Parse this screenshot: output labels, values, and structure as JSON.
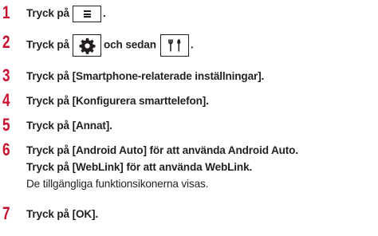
{
  "steps": [
    {
      "num": "1",
      "pre": "Tryck på",
      "icon": "menu-icon",
      "post": "."
    },
    {
      "num": "2",
      "pre": "Tryck på",
      "icon": "settings-gear-icon",
      "mid": "och sedan",
      "icon2": "tools-icon",
      "post": "."
    },
    {
      "num": "3",
      "text": "Tryck på [Smartphone-relaterade inställningar]."
    },
    {
      "num": "4",
      "text": "Tryck på [Konfigurera smarttelefon]."
    },
    {
      "num": "5",
      "text": "Tryck på [Annat]."
    },
    {
      "num": "6",
      "text": "Tryck på [Android Auto] för att använda Android Auto.",
      "text2": "Tryck på [WebLink] för att använda WebLink.",
      "note": "De tillgängliga funktionsikonerna visas."
    },
    {
      "num": "7",
      "text": "Tryck på [OK]."
    }
  ]
}
